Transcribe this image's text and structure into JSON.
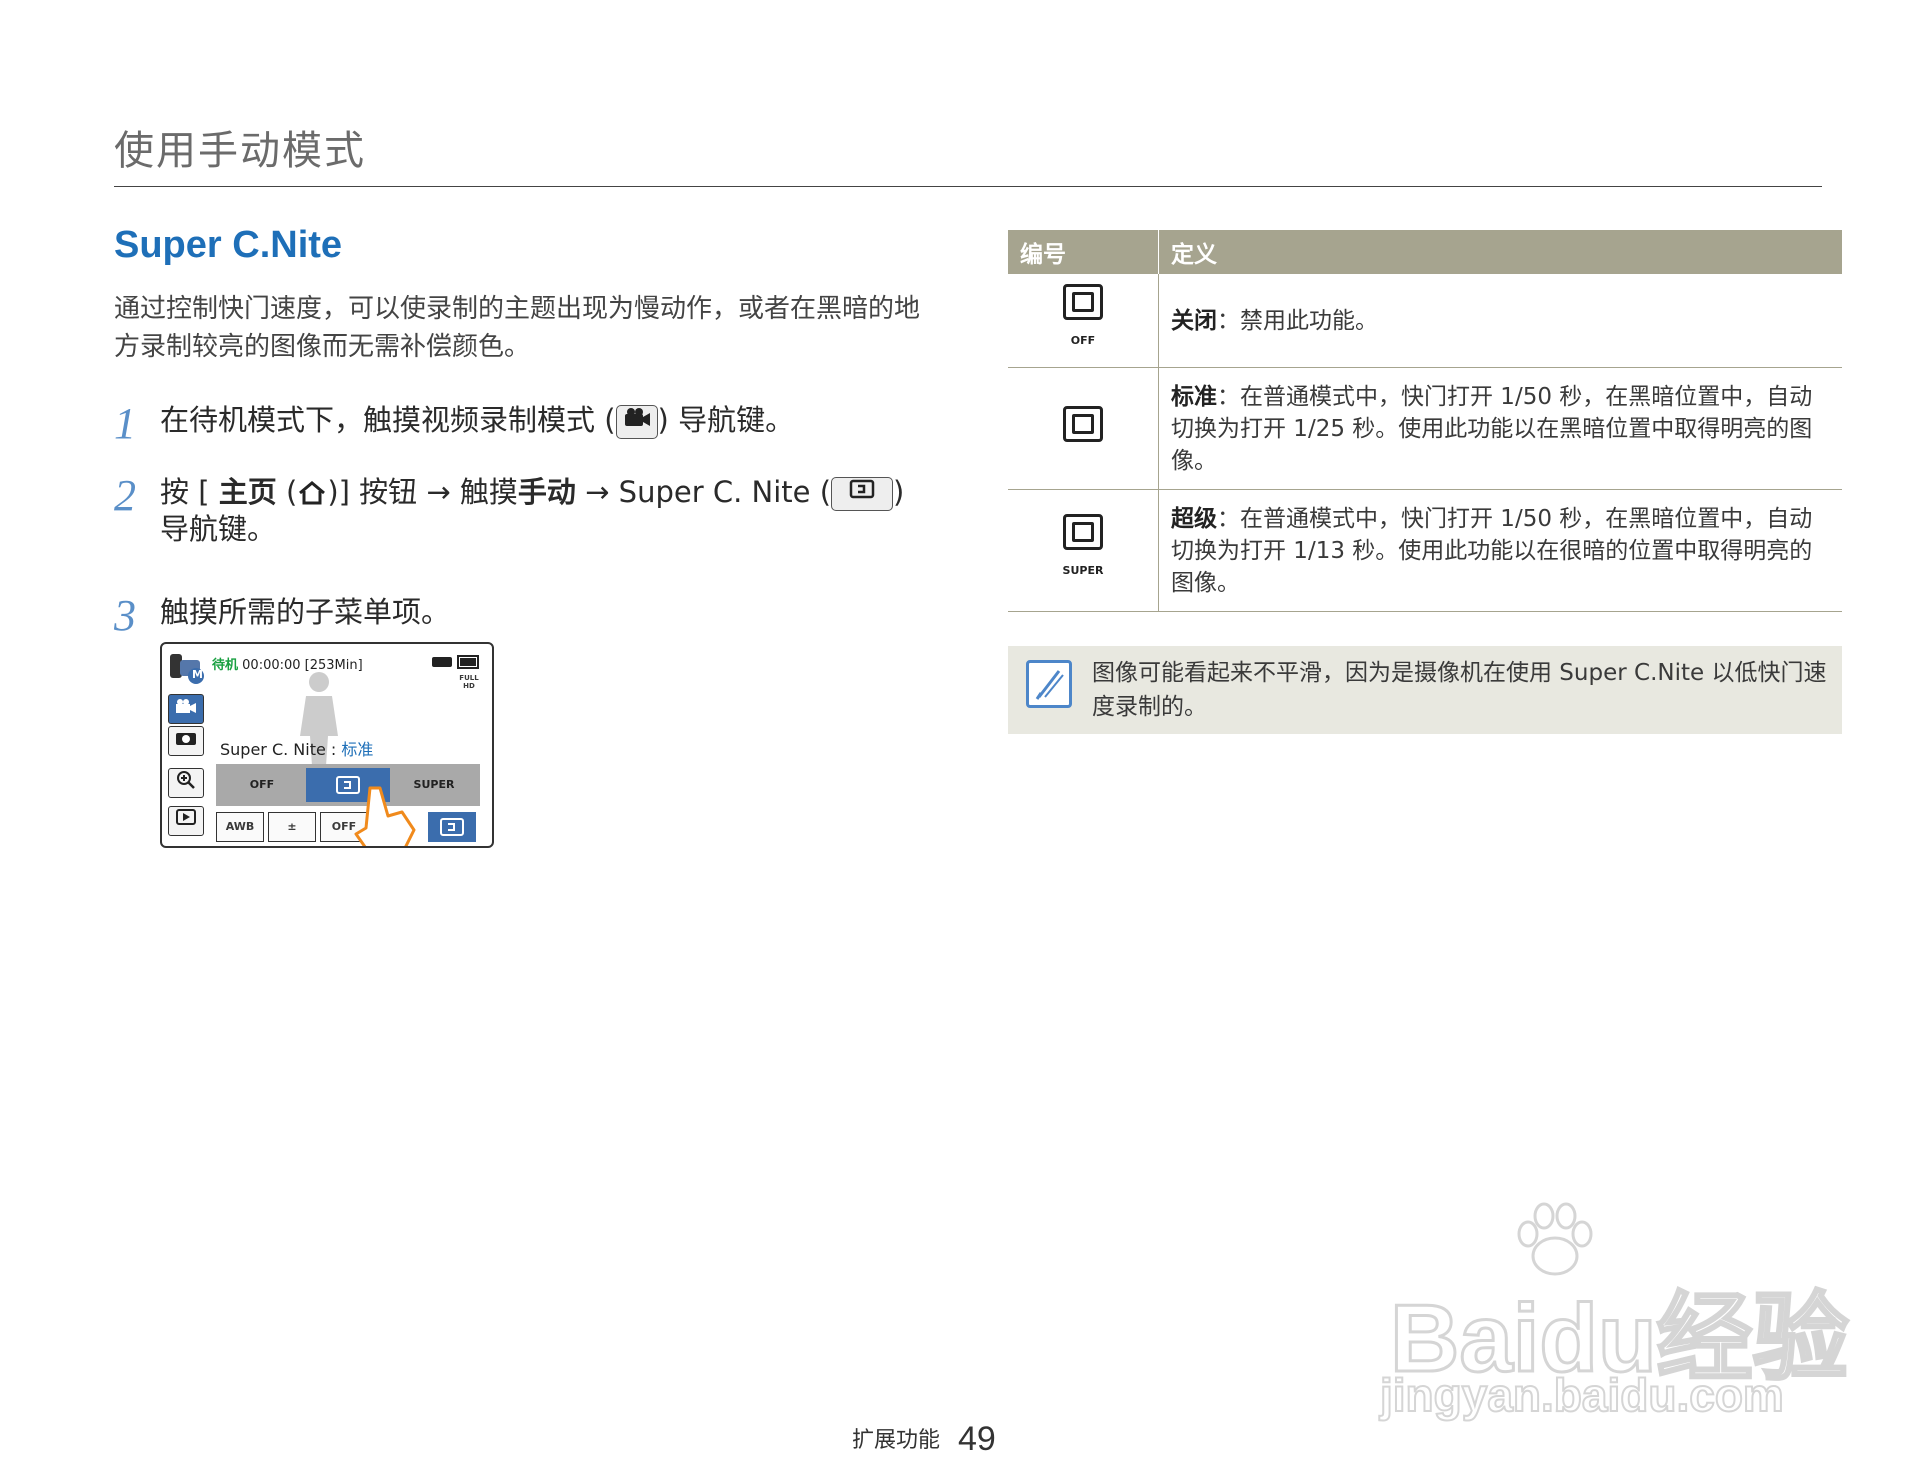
{
  "header": {
    "title": "使用手动模式"
  },
  "section": {
    "title": "Super C.Nite",
    "intro": "通过控制快门速度，可以使录制的主题出现为慢动作，或者在黑暗的地方录制较亮的图像而无需补偿颜色。"
  },
  "steps": [
    {
      "num": "1",
      "pre": "在待机模式下，触摸视频录制模式 (",
      "post": ") 导航键。"
    },
    {
      "num": "2",
      "p1": "按 [ ",
      "home": "主页",
      "p2": " (",
      "p3": ")] 按钮 → 触摸",
      "manual": "手动",
      "p4": " → Super C. Nite (",
      "p5": ")",
      "line2": "导航键。"
    },
    {
      "num": "3",
      "text": "触摸所需的子菜单项。"
    }
  ],
  "lcd": {
    "standby": "待机",
    "time": "00:00:00 [253Min]",
    "mode_badge": "M",
    "fullhd": "FULL HD",
    "label": "Super C. Nite : ",
    "label_value": "标准",
    "options": [
      "OFF",
      "",
      "SUPER"
    ],
    "bottom": [
      "AWB",
      "±",
      "OFF",
      ""
    ]
  },
  "table": {
    "headers": [
      "编号",
      "定义"
    ],
    "rows": [
      {
        "icon_sub": "OFF",
        "term": "关闭",
        "desc": "：禁用此功能。"
      },
      {
        "icon_sub": "",
        "term": "标准",
        "desc": "：在普通模式中，快门打开 1/50 秒，在黑暗位置中，自动切换为打开 1/25 秒。使用此功能以在黑暗位置中取得明亮的图像。"
      },
      {
        "icon_sub": "SUPER",
        "term": "超级",
        "desc": "：在普通模式中，快门打开 1/50 秒，在黑暗位置中，自动切换为打开 1/13 秒。使用此功能以在很暗的位置中取得明亮的图像。"
      }
    ]
  },
  "note": {
    "text": "图像可能看起来不平滑，因为是摄像机在使用 Super C.Nite 以低快门速度录制的。"
  },
  "footer": {
    "section": "扩展功能",
    "page": "49"
  },
  "watermark": {
    "brand": "Baidu经验",
    "url": "jingyan.baidu.com"
  }
}
